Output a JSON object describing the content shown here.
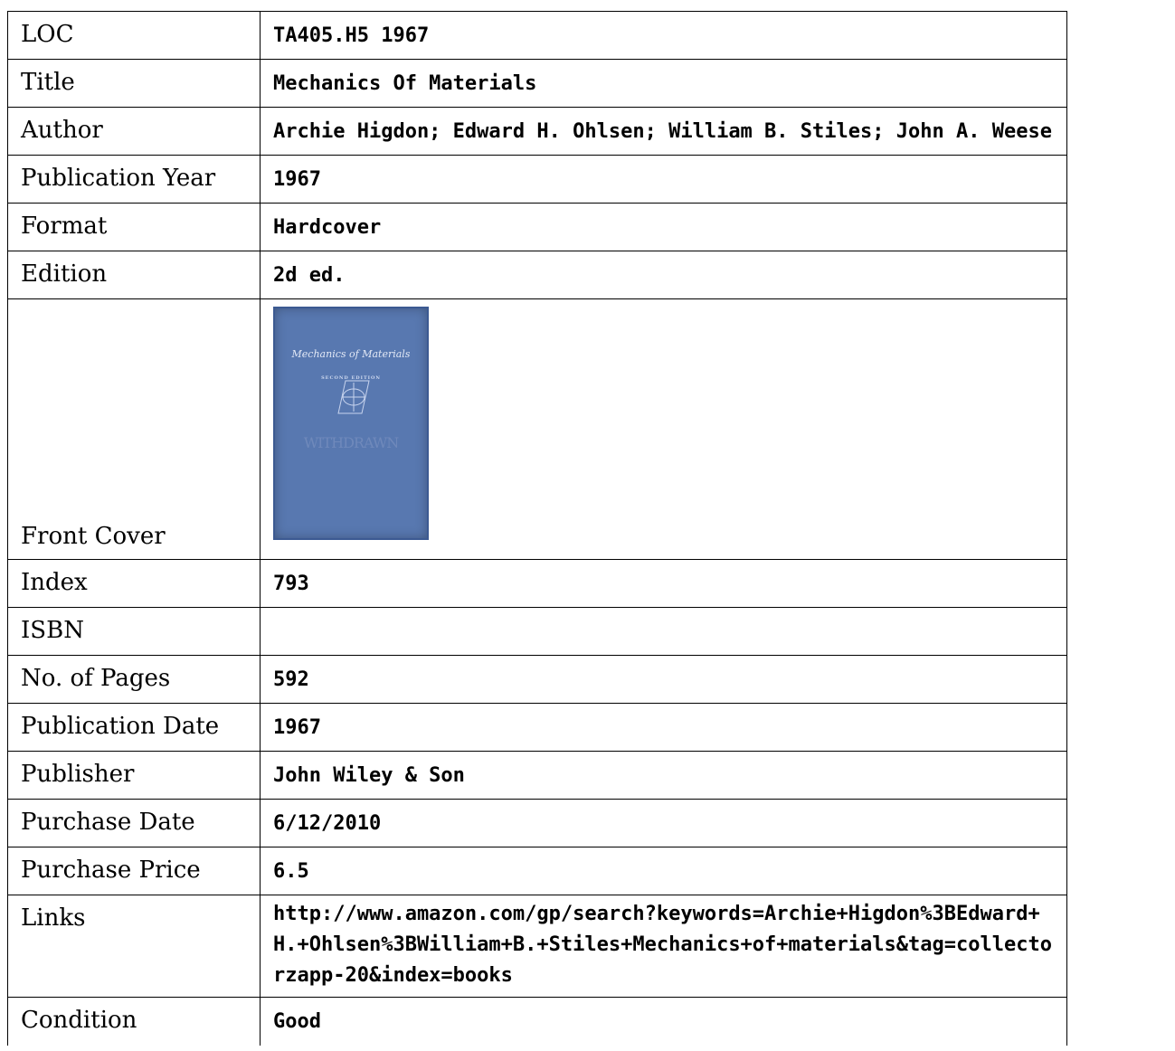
{
  "rows": [
    {
      "label": "LOC",
      "value": "TA405.H5 1967"
    },
    {
      "label": "Title",
      "value": "Mechanics Of Materials"
    },
    {
      "label": "Author",
      "value": "Archie Higdon; Edward H. Ohlsen; William B. Stiles; John A. Weese"
    },
    {
      "label": "Publication Year",
      "value": "1967"
    },
    {
      "label": "Format",
      "value": "Hardcover"
    },
    {
      "label": "Edition",
      "value": "2d ed."
    },
    {
      "label": "Front Cover"
    },
    {
      "label": "Index",
      "value": "793"
    },
    {
      "label": "ISBN",
      "value": ""
    },
    {
      "label": "No. of Pages",
      "value": "592"
    },
    {
      "label": "Publication Date",
      "value": "1967"
    },
    {
      "label": "Publisher",
      "value": "John Wiley & Son"
    },
    {
      "label": "Purchase Date",
      "value": "6/12/2010"
    },
    {
      "label": "Purchase Price",
      "value": "6.5"
    },
    {
      "label": "Links",
      "value": "http://www.amazon.com/gp/search?keywords=Archie+Higdon%3BEdward+H.+Ohlsen%3BWilliam+B.+Stiles+Mechanics+of+materials&tag=collectorzapp-20&index=books"
    },
    {
      "label": "Condition",
      "value": "Good"
    }
  ],
  "cover": {
    "title": "Mechanics of Materials",
    "subtitle": "SECOND EDITION",
    "stamp": "WITHDRAWN",
    "color": "#5878b0"
  }
}
